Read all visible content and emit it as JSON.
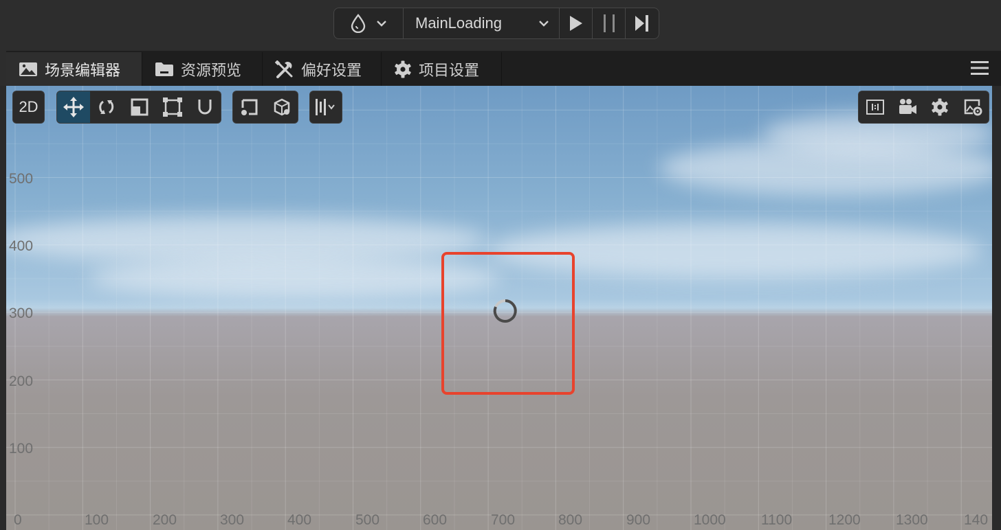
{
  "toolbar": {
    "engine_icon": "drop-icon",
    "scene_name": "MainLoading",
    "play_icon": "play-icon",
    "pause_icon": "pause-icon",
    "step_icon": "step-icon"
  },
  "tabs": [
    {
      "label": "场景编辑器",
      "icon": "scene-image-icon",
      "active": true
    },
    {
      "label": "资源预览",
      "icon": "folder-icon",
      "active": false
    },
    {
      "label": "偏好设置",
      "icon": "tools-icon",
      "active": false
    },
    {
      "label": "项目设置",
      "icon": "gear-icon",
      "active": false
    }
  ],
  "viewport_toolbar": {
    "mode_2d_label": "2D",
    "tools": [
      "move-icon",
      "rotate-icon",
      "scale-icon",
      "rect-icon",
      "snap-magnet-icon"
    ],
    "pivot_tools": [
      "pivot-icon",
      "local-global-icon"
    ],
    "align_tool": "align-icon",
    "right_tools": [
      "one-to-one-icon",
      "camera-icon",
      "settings-gear-icon",
      "scene-settings-icon"
    ]
  },
  "axes": {
    "y_labels": [
      "500",
      "400",
      "300",
      "200",
      "100"
    ],
    "x_labels": [
      "0",
      "100",
      "200",
      "300",
      "400",
      "500",
      "600",
      "700",
      "800",
      "900",
      "1000",
      "1100",
      "1200",
      "1300",
      "140"
    ]
  },
  "colors": {
    "highlight": "#e8432d",
    "active_tool": "#1f4a63"
  }
}
